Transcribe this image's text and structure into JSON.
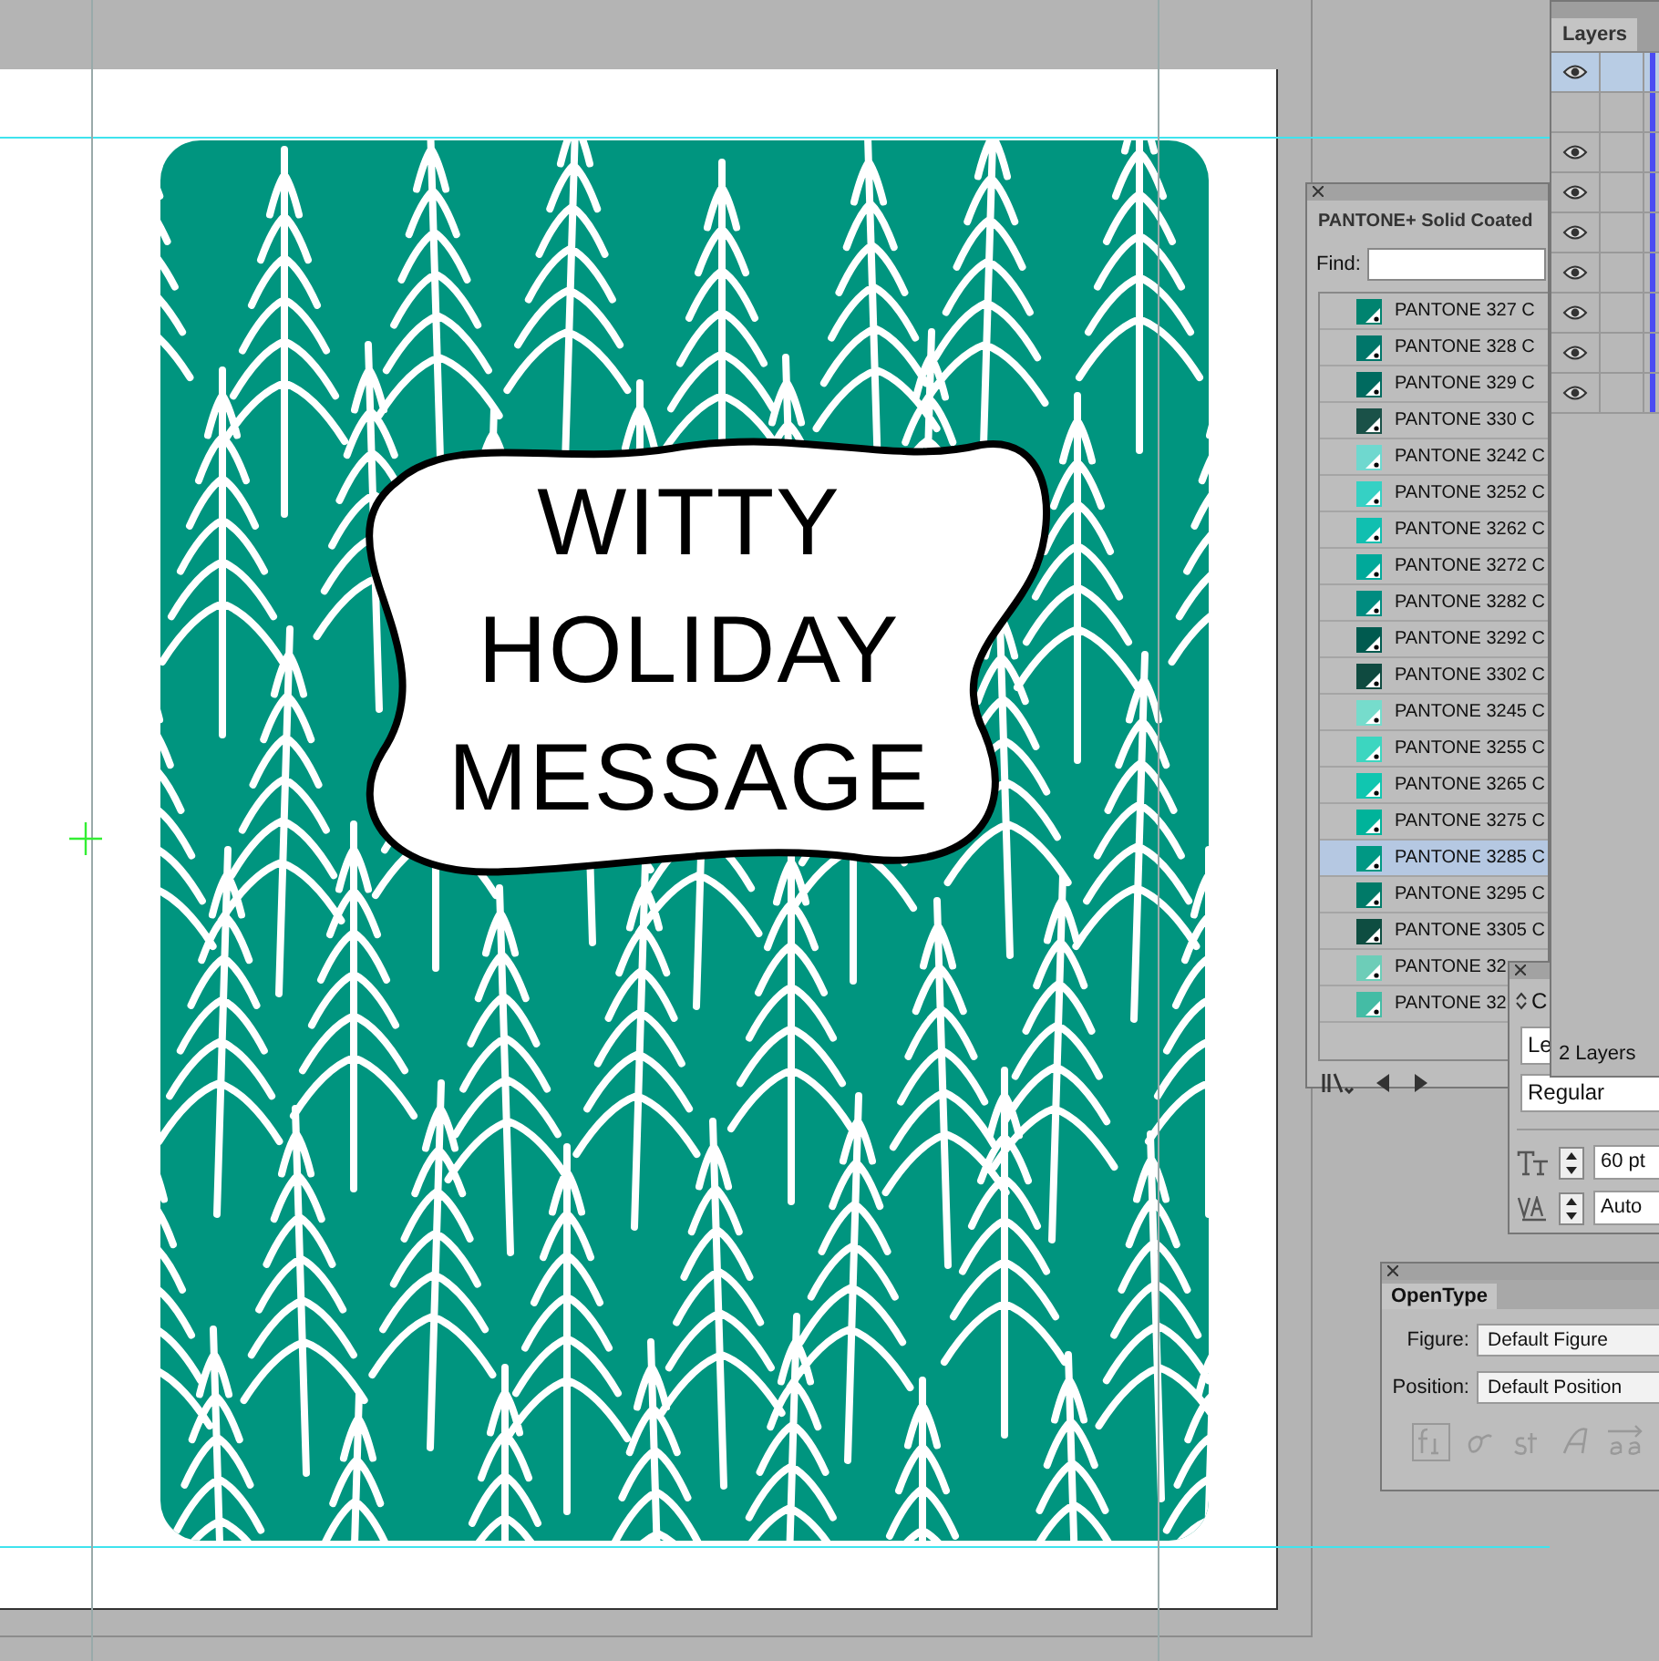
{
  "artboard": {
    "message": [
      "WITTY",
      "HOLIDAY",
      "MESSAGE"
    ]
  },
  "pantone_panel": {
    "title": "PANTONE+ Solid Coated",
    "find_label": "Find:",
    "swatches": [
      {
        "name": "PANTONE 327 C",
        "color": "#00836f",
        "selected": false
      },
      {
        "name": "PANTONE 328 C",
        "color": "#00766a",
        "selected": false
      },
      {
        "name": "PANTONE 329 C",
        "color": "#006a5f",
        "selected": false
      },
      {
        "name": "PANTONE 330 C",
        "color": "#1a5148",
        "selected": false
      },
      {
        "name": "PANTONE 3242 C",
        "color": "#6fd8cf",
        "selected": false
      },
      {
        "name": "PANTONE 3252 C",
        "color": "#35d1c4",
        "selected": false
      },
      {
        "name": "PANTONE 3262 C",
        "color": "#10bfb0",
        "selected": false
      },
      {
        "name": "PANTONE 3272 C",
        "color": "#00a99a",
        "selected": false
      },
      {
        "name": "PANTONE 3282 C",
        "color": "#008c80",
        "selected": false
      },
      {
        "name": "PANTONE 3292 C",
        "color": "#005a4f",
        "selected": false
      },
      {
        "name": "PANTONE 3302 C",
        "color": "#0f4a40",
        "selected": false
      },
      {
        "name": "PANTONE 3245 C",
        "color": "#76dccc",
        "selected": false
      },
      {
        "name": "PANTONE 3255 C",
        "color": "#3cd6c0",
        "selected": false
      },
      {
        "name": "PANTONE 3265 C",
        "color": "#10c6b0",
        "selected": false
      },
      {
        "name": "PANTONE 3275 C",
        "color": "#00b39a",
        "selected": false
      },
      {
        "name": "PANTONE 3285 C",
        "color": "#009884",
        "selected": true
      },
      {
        "name": "PANTONE 3295 C",
        "color": "#007a68",
        "selected": false
      },
      {
        "name": "PANTONE 3305 C",
        "color": "#0e4d41",
        "selected": false
      },
      {
        "name": "PANTONE 32",
        "color": "#6dcdb8",
        "selected": false
      },
      {
        "name": "PANTONE 32",
        "color": "#44bca5",
        "selected": false
      }
    ]
  },
  "layers_panel": {
    "tab": "Layers",
    "rows": [
      {
        "visible": true,
        "selected": true
      },
      {
        "visible": false,
        "selected": false
      },
      {
        "visible": true,
        "selected": false
      },
      {
        "visible": true,
        "selected": false
      },
      {
        "visible": true,
        "selected": false
      },
      {
        "visible": true,
        "selected": false
      },
      {
        "visible": true,
        "selected": false
      },
      {
        "visible": true,
        "selected": false
      },
      {
        "visible": true,
        "selected": false
      }
    ],
    "footer": "2 Layers"
  },
  "character_panel": {
    "title": "C",
    "font_family": "Le",
    "font_style": "Regular",
    "font_size": "60 pt",
    "leading": "Auto"
  },
  "opentype_panel": {
    "tab": "OpenType",
    "figure_label": "Figure:",
    "figure": "Default Figure",
    "position_label": "Position:",
    "position": "Default Position"
  }
}
